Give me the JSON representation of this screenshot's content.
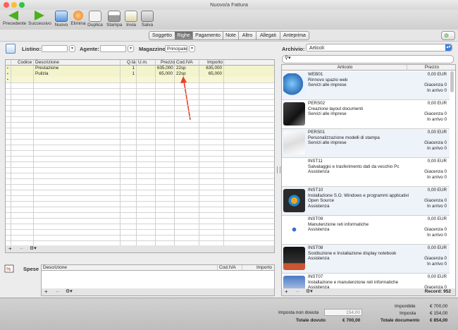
{
  "window": {
    "title": "Nuovo/a Fattura"
  },
  "toolbar": {
    "prev": "Precedente",
    "next": "Successivo",
    "new": "Nuovo",
    "delete": "Elimina",
    "duplicate": "Duplica",
    "print": "Stampa",
    "send": "Invia",
    "save": "Salva"
  },
  "tabs": [
    "Soggetto",
    "Righe",
    "Pagamento",
    "Note",
    "Altro",
    "Allegati",
    "Anteprima"
  ],
  "active_tab": "Righe",
  "form": {
    "listino_label": "Listino:",
    "listino_value": "",
    "agente_label": "Agente:",
    "agente_value": "",
    "magazzino_label": "Magazzino:",
    "magazzino_value": "Principale"
  },
  "grid": {
    "headers": [
      "Codice",
      "Descrizione",
      "Q.tà",
      "U.m.",
      "Prezzo",
      "Cod.IVA",
      "Importo"
    ],
    "rows": [
      {
        "codice": "",
        "descrizione": "Prestazione",
        "qta": "1",
        "um": "",
        "prezzo": "635,000",
        "iva": "22sp",
        "importo": "635,000"
      },
      {
        "codice": "",
        "descrizione": "Pulizia",
        "qta": "1",
        "um": "",
        "prezzo": "65,000",
        "iva": "22sp",
        "importo": "65,000"
      }
    ]
  },
  "spese": {
    "label": "Spese",
    "headers": [
      "Descrizione",
      "Cod.IVA",
      "Importo"
    ]
  },
  "archive": {
    "label": "Archivio:",
    "value": "Articoli",
    "search_placeholder": "",
    "col_articolo": "Articolo",
    "col_prezzo": "Prezzo",
    "items": [
      {
        "code": "WEB01",
        "name": "Rinnovo spazio web",
        "category": "Servizi alle imprese",
        "price": "0,00 EUR",
        "giacenza": "Giacenza 0",
        "arrivo": "In arrivo 0"
      },
      {
        "code": "PERS02",
        "name": "Creazione layout documenti",
        "category": "Servizi alle imprese",
        "price": "0,00 EUR",
        "giacenza": "Giacenza 0",
        "arrivo": "In arrivo 0"
      },
      {
        "code": "PERS01",
        "name": "Personalizzazione modelli di stampa",
        "category": "Servizi alle imprese",
        "price": "0,00 EUR",
        "giacenza": "Giacenza 0",
        "arrivo": "In arrivo 0"
      },
      {
        "code": "INST11",
        "name": "Salvataggio e trasferimento dati da vecchio Pc",
        "category": "Assistenza",
        "price": "0,00 EUR",
        "giacenza": "Giacenza 0",
        "arrivo": "In arrivo 0"
      },
      {
        "code": "INST10",
        "name": "Installazione S.O. Windows e programmi applicativi",
        "category": "Open Source\nAssistenza",
        "price": "0,00 EUR",
        "giacenza": "Giacenza 0",
        "arrivo": "In arrivo 0"
      },
      {
        "code": "INST09",
        "name": "Manutenzione reti informatiche",
        "category": "Assistenza",
        "price": "0,00 EUR",
        "giacenza": "Giacenza 0",
        "arrivo": "In arrivo 0"
      },
      {
        "code": "INST08",
        "name": "Sostituzione e Installazione display notebook",
        "category": "Assistenza",
        "price": "0,00 EUR",
        "giacenza": "Giacenza 0",
        "arrivo": "In arrivo 0"
      },
      {
        "code": "INST07",
        "name": "Installazione e manutenzione reti informatiche",
        "category": "Assistenza",
        "price": "0,00 EUR",
        "giacenza": "Giacenza 0",
        "arrivo": ""
      }
    ],
    "record_count": "Record: 952"
  },
  "totals": {
    "imponibile_label": "Imponibile",
    "imponibile": "€ 700,00",
    "imposta_label": "Imposta",
    "imposta": "€ 154,00",
    "non_dovuta_label": "Imposta non dovuta",
    "non_dovuta": "154,00",
    "totale_dovuto_label": "Totale dovuto",
    "totale_dovuto": "€ 700,00",
    "totale_documento_label": "Totale documento",
    "totale_documento": "€ 854,00"
  }
}
